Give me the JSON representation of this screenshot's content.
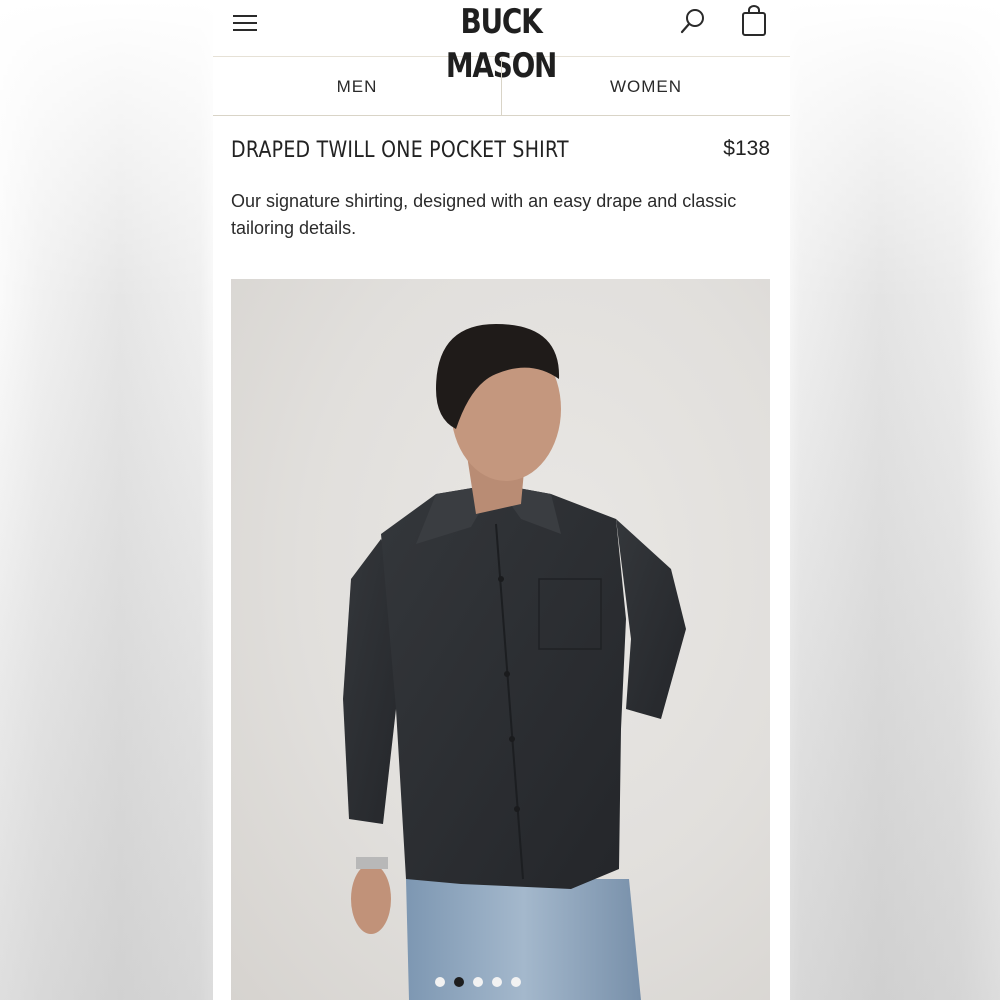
{
  "header": {
    "brand": "BUCK MASON",
    "menu_icon": "hamburger-menu-icon",
    "search_icon": "search-icon",
    "cart_icon": "shopping-bag-icon"
  },
  "tabs": [
    {
      "label": "MEN"
    },
    {
      "label": "WOMEN"
    }
  ],
  "product": {
    "title": "DRAPED TWILL ONE POCKET SHIRT",
    "price": "$138",
    "description": "Our signature shirting, designed with an easy drape and classic tailoring details."
  },
  "gallery": {
    "image_count": 5,
    "active_index": 1
  },
  "colors": {
    "text": "#222222",
    "divider": "#d9d4c7",
    "image_bg": "#e1dfdc",
    "shirt": "#2b2d30",
    "jeans": "#8aa3bd"
  }
}
